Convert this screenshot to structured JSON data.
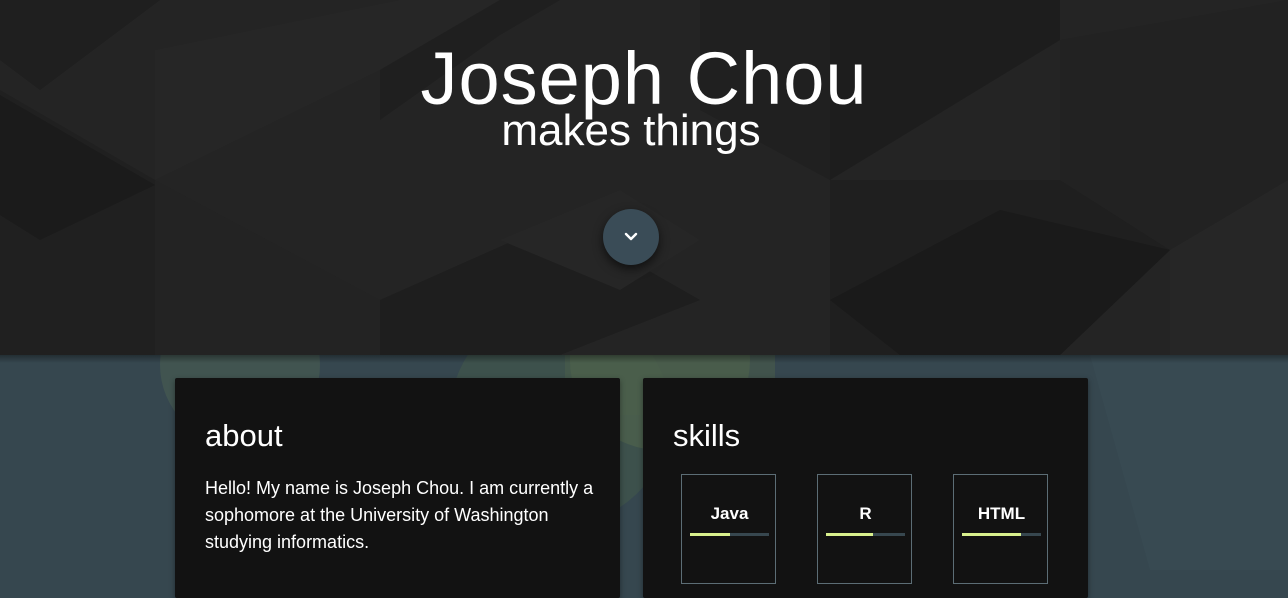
{
  "hero": {
    "title": "Joseph Chou",
    "subtitle": "makes things",
    "scroll_icon": "chevron-down-icon"
  },
  "about": {
    "title": "about",
    "text": "Hello! My name is Joseph Chou. I am currently a sophomore at the University of Washington studying informatics."
  },
  "skills": {
    "title": "skills",
    "items": [
      {
        "name": "Java",
        "level": 0.5
      },
      {
        "name": "R",
        "level": 0.6
      },
      {
        "name": "HTML",
        "level": 0.75
      }
    ]
  },
  "colors": {
    "hero_bg": "#232323",
    "lower_bg": "#36474f",
    "card_bg": "#121212",
    "accent": "#d8f08d",
    "button": "#3a4c57"
  }
}
